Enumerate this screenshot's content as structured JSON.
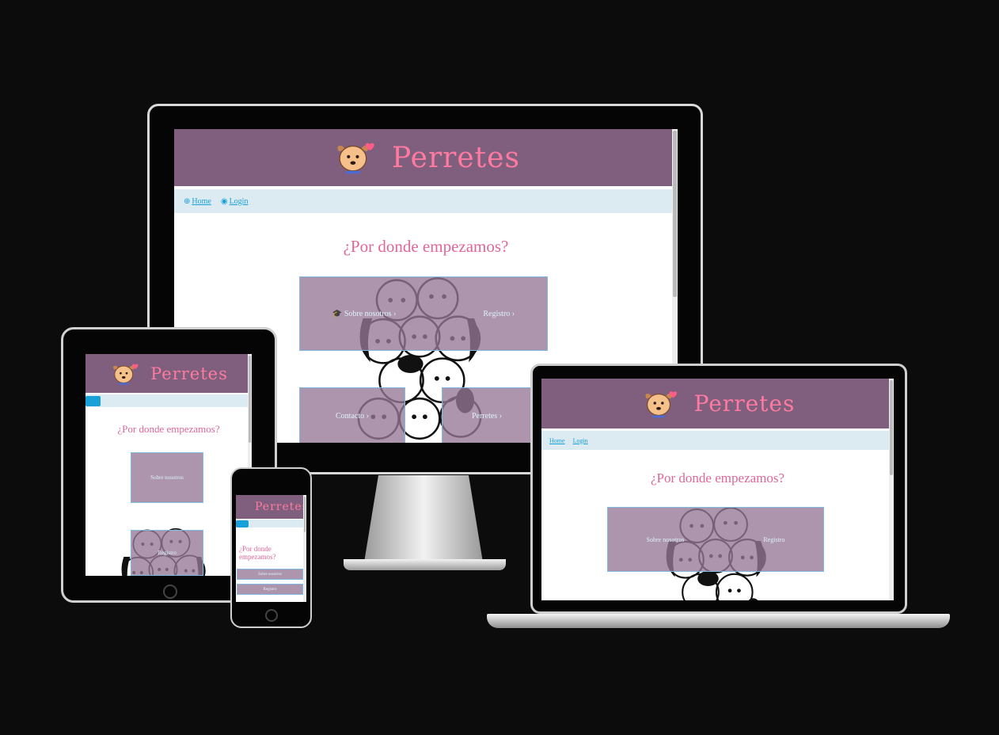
{
  "site": {
    "brand": "Perretes",
    "heading": "¿Por donde empezamos?",
    "nav": {
      "home": "Home",
      "login": "Login"
    },
    "tiles": {
      "about": "Sobre nosotros",
      "register": "Registro",
      "contact": "Contacto",
      "dogs": "Perretes"
    }
  },
  "colors": {
    "background": "#0d0c0d",
    "header": "#7f5f7d",
    "brand": "#ff7aa0",
    "nav_bg": "#dcebf2",
    "link": "#1aa0d8",
    "heading": "#e0669a"
  }
}
